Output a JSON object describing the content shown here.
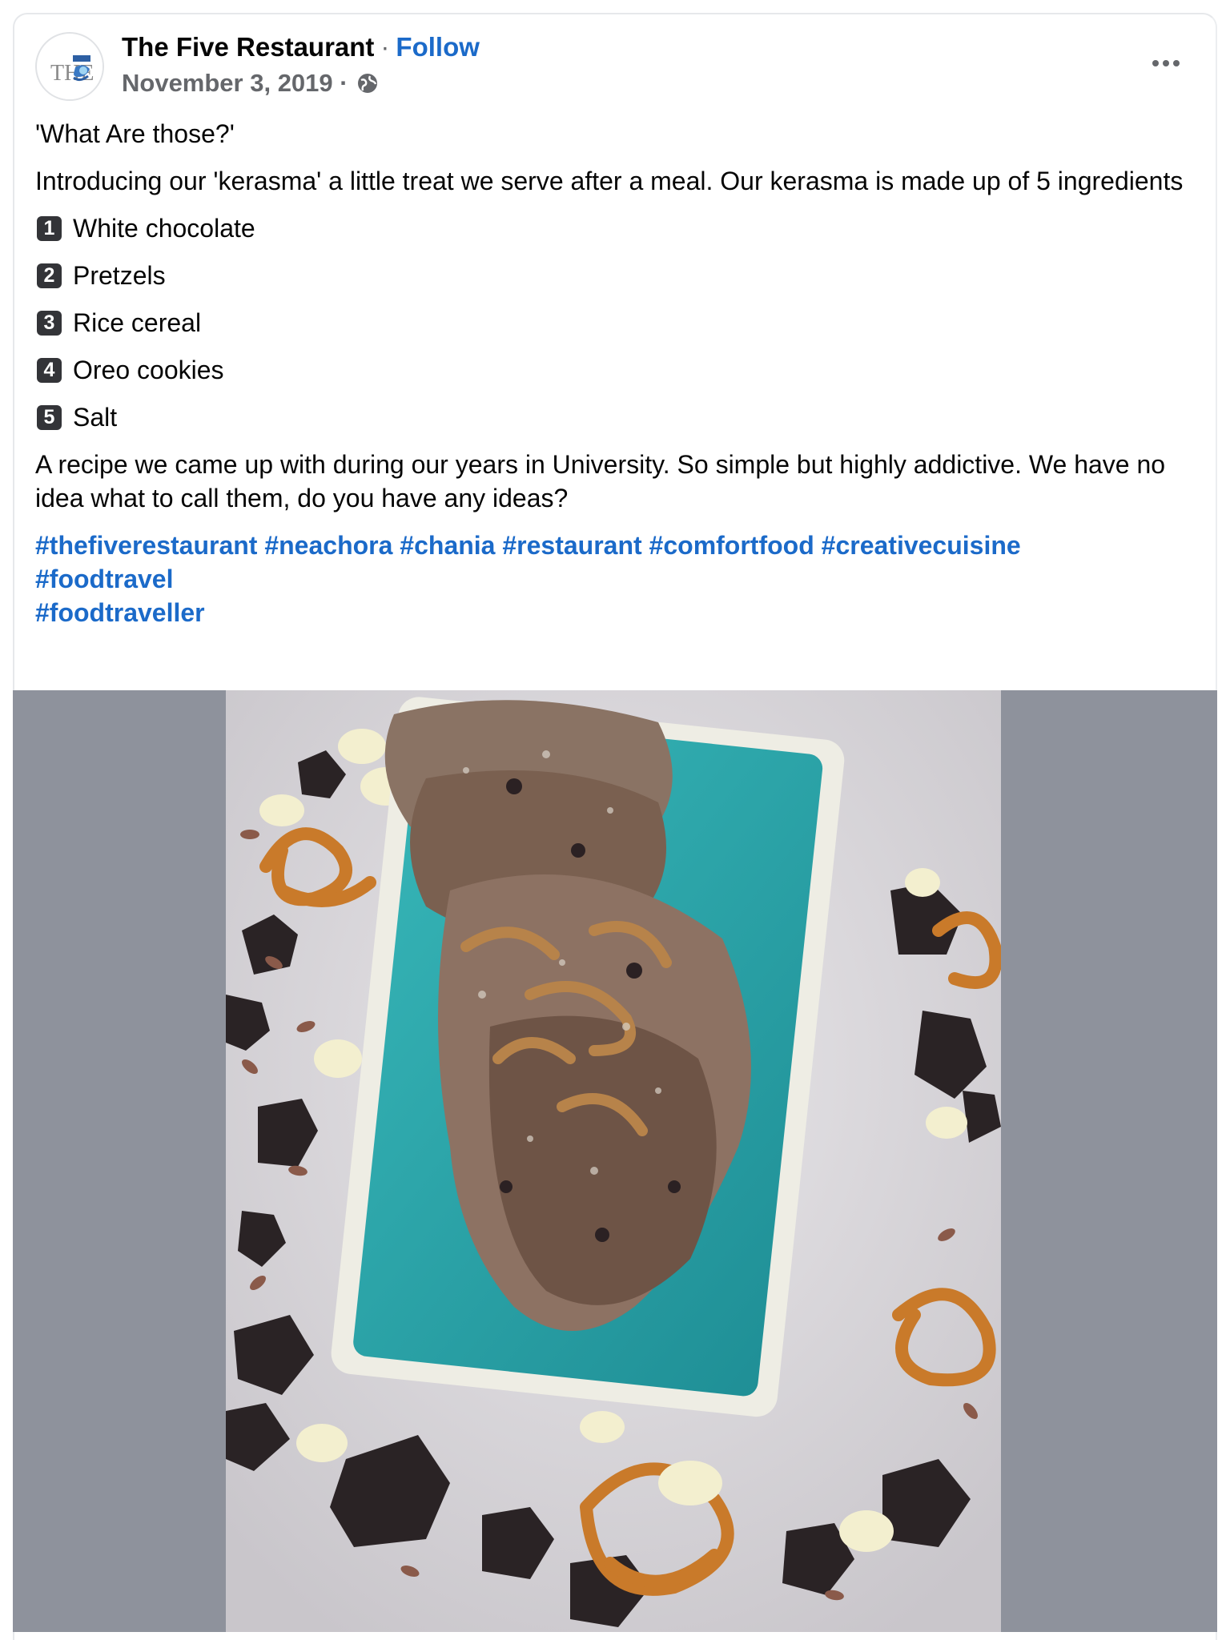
{
  "post": {
    "page_name": "The Five Restaurant",
    "separator": "·",
    "follow_label": "Follow",
    "date": "November 3, 2019 ·",
    "audience_icon": "globe-icon",
    "more_icon": "more-options-icon",
    "avatar_icon": "restaurant-logo",
    "title_line": "'What Are those?'",
    "intro": "Introducing our 'kerasma' a little treat we serve after a meal. Our kerasma is made up of 5 ingredients",
    "ingredients": [
      {
        "num": "1",
        "label": "White chocolate"
      },
      {
        "num": "2",
        "label": "Pretzels"
      },
      {
        "num": "3",
        "label": "Rice cereal"
      },
      {
        "num": "4",
        "label": "Oreo cookies"
      },
      {
        "num": "5",
        "label": "Salt"
      }
    ],
    "closing": "A recipe we came up with during our years in University. So simple but highly addictive. We have no idea what to call them, do you have any ideas?",
    "hashtags": [
      "#thefiverestaurant",
      "#neachora",
      "#chania",
      "#restaurant",
      "#comfortfood",
      "#creativecuisine",
      "#foodtravel",
      "#foodtraveller"
    ]
  },
  "photo": {
    "description_icon": "food-photo",
    "colors": {
      "backdrop": "#8e929c",
      "plate": "#2aa9ad",
      "link": "#1b6ac9"
    }
  }
}
